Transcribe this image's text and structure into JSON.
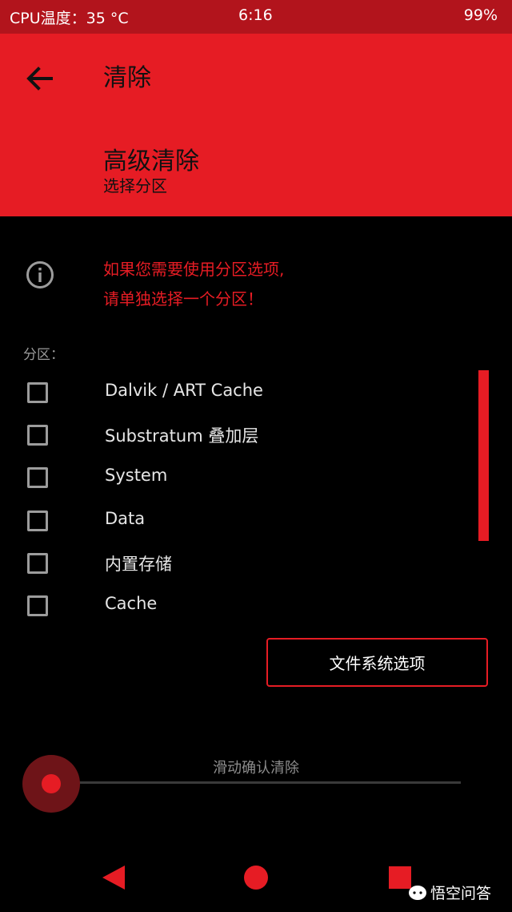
{
  "status_bar": {
    "cpu_temp": "CPU温度：35 °C",
    "time": "6:16",
    "battery": "99%"
  },
  "header": {
    "title": "清除",
    "subtitle": "高级清除",
    "caption": "选择分区"
  },
  "info": {
    "line1": "如果您需要使用分区选项,",
    "line2": "请单独选择一个分区！"
  },
  "partitions_label": "分区：",
  "partitions": [
    {
      "label": "Dalvik / ART Cache",
      "checked": false
    },
    {
      "label": "Substratum 叠加层",
      "checked": false
    },
    {
      "label": "System",
      "checked": false
    },
    {
      "label": "Data",
      "checked": false
    },
    {
      "label": "内置存储",
      "checked": false
    },
    {
      "label": "Cache",
      "checked": false
    }
  ],
  "fs_options_button": "文件系统选项",
  "swipe": {
    "label": "滑动确认清除",
    "progress": 0
  },
  "watermark": "悟空问答",
  "colors": {
    "accent": "#e61c24",
    "status_bar": "#b2141c",
    "background": "#000000"
  },
  "icons": {
    "back": "arrow-left-icon",
    "info": "info-circle-icon",
    "nav_back": "triangle-left-icon",
    "nav_home": "circle-icon",
    "nav_recent": "square-icon"
  }
}
